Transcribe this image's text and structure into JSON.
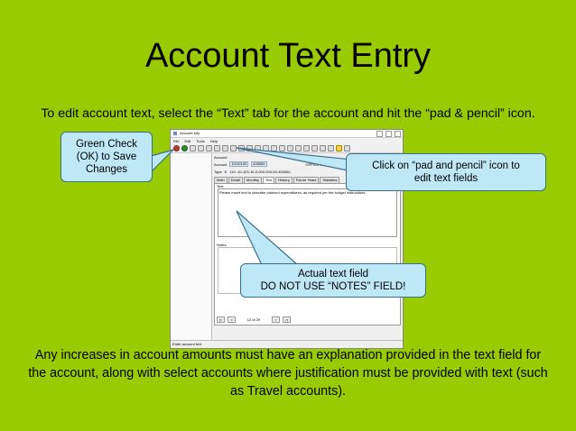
{
  "slide": {
    "title": "Account Text Entry",
    "intro": "To edit account text, select the “Text” tab for the account and hit the “pad & pencil” icon.",
    "footer": "Any increases in account amounts must have an explanation provided in the text field for the account, along with select accounts where justification must be provided with text (such as Travel accounts)."
  },
  "callouts": {
    "save": [
      "Green Check",
      "(OK) to Save",
      "Changes"
    ],
    "pad": [
      "Click on “pad and pencil” icon to",
      "edit text fields"
    ],
    "field": [
      "Actual text field",
      "DO NOT USE “NOTES” FIELD!"
    ]
  },
  "window": {
    "title": "Account Info",
    "menu": [
      "File",
      "Edit",
      "Tools",
      "Help"
    ],
    "account_label": "Account",
    "account_value": "101/0120",
    "account_sub": "426000",
    "office_label": "OFFICE OF",
    "type_label": "Type",
    "type_value": "E",
    "account_string": "110 -10-123-10-0-000-000-00-426000-",
    "tabs": [
      "Main",
      "Detail",
      "Monthly",
      "Text",
      "History",
      "Future Years",
      "Statistics"
    ],
    "active_tab": "Text",
    "text_label": "Text",
    "text_value": "Please insert text to describe planned expenditures, as required per the budget instructions.",
    "notes_label": "Notes",
    "pager": "12 of 29",
    "status": "Enter account text"
  }
}
